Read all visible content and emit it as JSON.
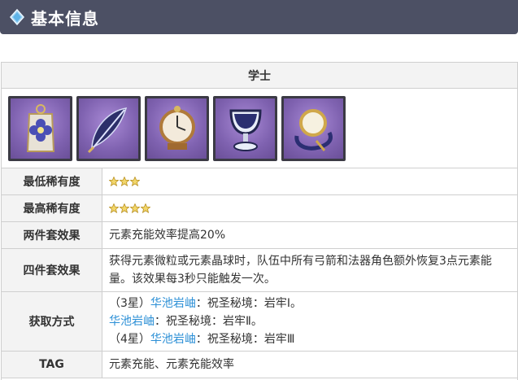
{
  "header": {
    "title": "基本信息"
  },
  "card": {
    "title": "学士",
    "items": [
      {
        "icon": "flower-tag-icon"
      },
      {
        "icon": "feather-quill-icon"
      },
      {
        "icon": "pocket-clock-icon"
      },
      {
        "icon": "goblet-icon"
      },
      {
        "icon": "monocle-circlet-icon"
      }
    ],
    "rows": {
      "min_rarity": {
        "label": "最低稀有度",
        "stars": 3
      },
      "max_rarity": {
        "label": "最高稀有度",
        "stars": 4
      },
      "two_piece": {
        "label": "两件套效果",
        "value": "元素充能效率提高20%"
      },
      "four_piece": {
        "label": "四件套效果",
        "value": "获得元素微粒或元素晶球时，队伍中所有弓箭和法器角色额外恢复3点元素能量。该效果每3秒只能触发一次。"
      },
      "obtain": {
        "label": "获取方式",
        "line1_prefix": "（3星）",
        "line1_link": "华池岩岫",
        "line1_suffix": "：祝圣秘境：岩牢Ⅰ。",
        "line2_link": "华池岩岫",
        "line2_suffix": "：祝圣秘境：岩牢Ⅱ。",
        "line3_prefix": "（4星）",
        "line3_link": "华池岩岫",
        "line3_suffix": "：祝圣秘境：岩牢Ⅲ"
      },
      "tag": {
        "label": "TAG",
        "value": "元素充能、元素充能效率"
      }
    }
  },
  "colors": {
    "header_bg": "#4c5064",
    "link": "#2b8fd6",
    "item_bg": "#7f62b0"
  }
}
